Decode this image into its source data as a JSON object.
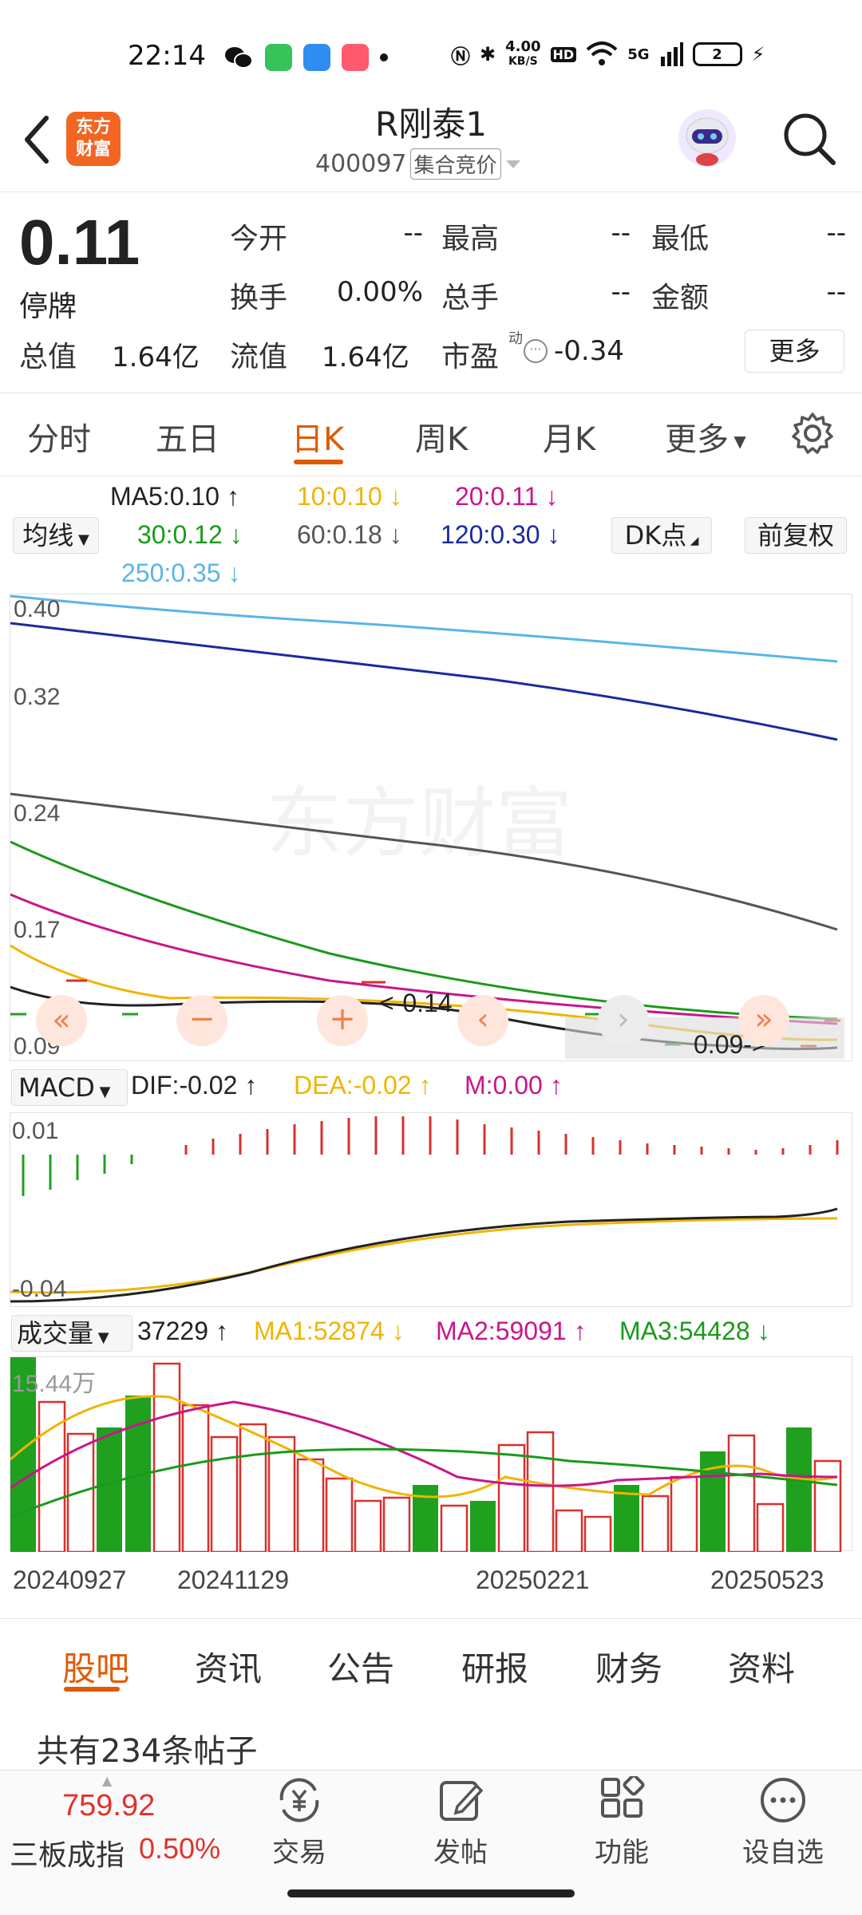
{
  "status": {
    "time": "22:14",
    "net_speed": "4.00",
    "net_unit": "KB/S",
    "hd": "HD",
    "signal": "5G",
    "battery": "2"
  },
  "header": {
    "logo_line1": "东方",
    "logo_line2": "财富",
    "title": "R刚泰1",
    "code": "400097",
    "auction_tag": "集合竞价"
  },
  "quote": {
    "price": "0.11",
    "status": "停牌",
    "open_label": "今开",
    "open_value": "--",
    "high_label": "最高",
    "high_value": "--",
    "low_label": "最低",
    "low_value": "--",
    "turnover_label": "换手",
    "turnover_value": "0.00%",
    "volume_label": "总手",
    "volume_value": "--",
    "amount_label": "金额",
    "amount_value": "--",
    "total_cap_label": "总值",
    "total_cap_value": "1.64亿",
    "float_cap_label": "流值",
    "float_cap_value": "1.64亿",
    "pe_label": "市盈",
    "pe_sup": "动",
    "pe_value": "-0.34",
    "more_label": "更多"
  },
  "tabs": [
    "分时",
    "五日",
    "日K",
    "周K",
    "月K",
    "更多"
  ],
  "indicator": {
    "ma_select": "均线",
    "ma5": "MA5:0.10",
    "ma10": "10:0.10",
    "ma20": "20:0.11",
    "ma30": "30:0.12",
    "ma60": "60:0.18",
    "ma120": "120:0.30",
    "ma250": "250:0.35",
    "dk_label": "DK点",
    "adjust_label": "前复权"
  },
  "colors": {
    "ma5": "#222222",
    "ma10": "#f0b400",
    "ma20": "#c8168c",
    "ma30": "#1a9a1a",
    "ma60": "#555555",
    "ma120": "#1a2a9c",
    "ma250": "#5bb4e8",
    "up": "#d9302c",
    "down": "#1fa01f",
    "accent": "#e05a00"
  },
  "kchart": {
    "y_labels": [
      "0.40",
      "0.32",
      "0.24",
      "0.17",
      "0.09"
    ],
    "annotation_low": "0.09->",
    "annotation_mid": "<-0.14",
    "watermark": "东方财富"
  },
  "macd": {
    "select": "MACD",
    "dif": "DIF:-0.02",
    "dea": "DEA:-0.02",
    "m": "M:0.00",
    "y_top": "0.01",
    "y_bottom": "-0.04"
  },
  "volume": {
    "select": "成交量",
    "value": "37229",
    "ma1": "MA1:52874",
    "ma2": "MA2:59091",
    "ma3": "MA3:54428",
    "y_top": "15.44万"
  },
  "dates": [
    "20240927",
    "20241129",
    "20250221",
    "20250523"
  ],
  "bottom_tabs": [
    "股吧",
    "资讯",
    "公告",
    "研报",
    "财务",
    "资料"
  ],
  "posts_text": "共有234条帖子",
  "bottom_bar": {
    "index_value": "759.92",
    "index_name": "三板成指",
    "index_pct": "0.50%",
    "nav": [
      "交易",
      "发帖",
      "功能",
      "设自选"
    ]
  }
}
